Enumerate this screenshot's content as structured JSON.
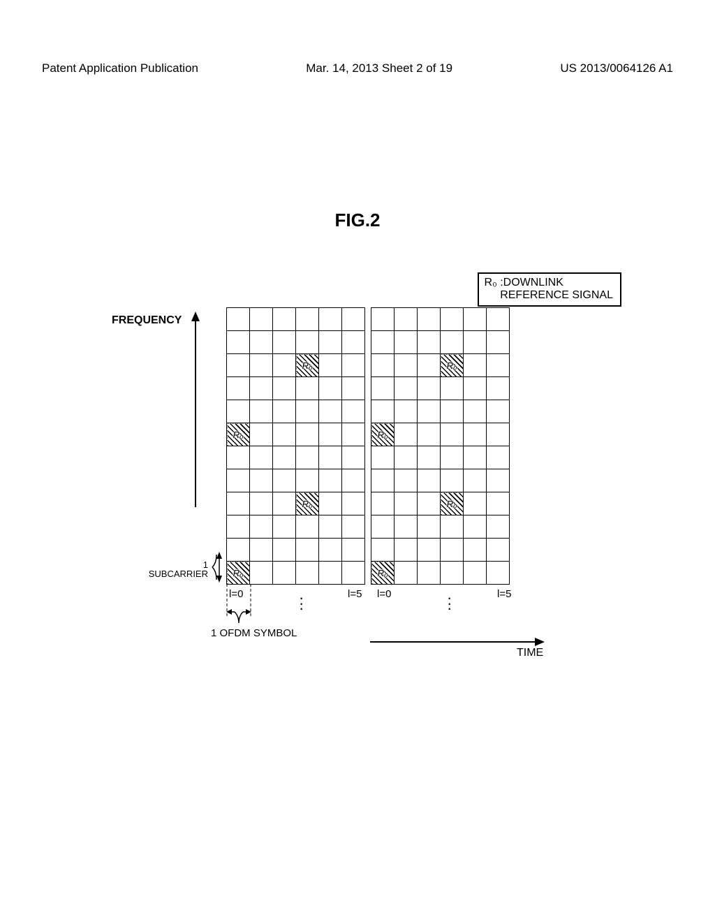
{
  "header": {
    "left": "Patent Application Publication",
    "center": "Mar. 14, 2013  Sheet 2 of 19",
    "right": "US 2013/0064126 A1"
  },
  "figure_title": "FIG.2",
  "legend": {
    "symbol": "R₀",
    "label_line1": ":DOWNLINK",
    "label_line2": " REFERENCE SIGNAL"
  },
  "axis_y": "FREQUENCY",
  "axis_x": "TIME",
  "unit_y": "1\nSUBCARRIER",
  "unit_x": "1 OFDM SYMBOL",
  "col_labels": {
    "slot1_first": "l=0",
    "slot1_last": "l=5",
    "slot2_first": "l=0",
    "slot2_last": "l=5"
  },
  "rs_label": "R₀",
  "chart_data": {
    "type": "table",
    "rows": 12,
    "cols_per_slot": 6,
    "slots": 2,
    "reference_signal_cells": [
      {
        "slot": 0,
        "row": 2,
        "col": 3
      },
      {
        "slot": 0,
        "row": 5,
        "col": 0
      },
      {
        "slot": 0,
        "row": 8,
        "col": 3
      },
      {
        "slot": 0,
        "row": 11,
        "col": 0
      },
      {
        "slot": 1,
        "row": 2,
        "col": 3
      },
      {
        "slot": 1,
        "row": 5,
        "col": 0
      },
      {
        "slot": 1,
        "row": 8,
        "col": 3
      },
      {
        "slot": 1,
        "row": 11,
        "col": 0
      }
    ],
    "title": "Downlink reference-signal resource grid",
    "xlabel": "OFDM symbol (time)",
    "ylabel": "Subcarrier (frequency)"
  }
}
